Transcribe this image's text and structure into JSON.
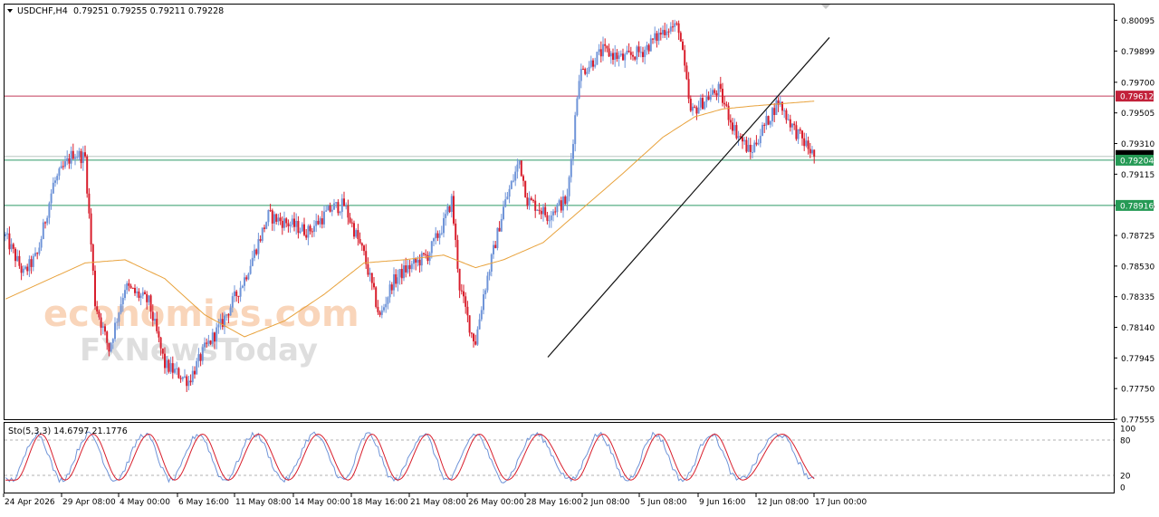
{
  "header": {
    "symbol_label": "USDCHF,H4",
    "ohlc_values": "0.79251 0.79255 0.79211 0.79228"
  },
  "watermark": {
    "line1": "economies.com",
    "line2": "FXNewsToday"
  },
  "indicator": {
    "label": "Sto(5,3,3) 14.6797 21.1776"
  },
  "colors": {
    "bull_candle": "#6f94d8",
    "bear_candle": "#d81e2c",
    "ma_line": "#e8a23c",
    "trendline": "#111111",
    "resistance_line": "#c23a5a",
    "support_line": "#2e9a68",
    "stoch_main": "#6f94d8",
    "stoch_signal": "#d81e2c",
    "price_badge_red": "#c2213a",
    "price_badge_green": "#259a55"
  },
  "chart_data": {
    "type": "candlestick",
    "symbol": "USDCHF",
    "timeframe": "H4",
    "ylim": [
      0.77555,
      0.80195
    ],
    "y_ticks": [
      "0.80095",
      "0.79899",
      "0.79700",
      "0.79505",
      "0.79310",
      "0.79115",
      "0.78916",
      "0.78725",
      "0.78530",
      "0.78335",
      "0.78140",
      "0.77945",
      "0.77750",
      "0.77555"
    ],
    "x_ticks": [
      "24 Apr 2026",
      "29 Apr 08:00",
      "4 May 00:00",
      "6 May 16:00",
      "11 May 08:00",
      "14 May 00:00",
      "18 May 16:00",
      "21 May 08:00",
      "26 May 00:00",
      "28 May 16:00",
      "2 Jun 08:00",
      "5 Jun 08:00",
      "9 Jun 16:00",
      "12 Jun 08:00",
      "17 Jun 00:00"
    ],
    "candle_count": 272,
    "path_anchors": [
      [
        0,
        0.7872
      ],
      [
        9,
        0.7848
      ],
      [
        16,
        0.786
      ],
      [
        24,
        0.7905
      ],
      [
        34,
        0.7925
      ],
      [
        40,
        0.7922
      ],
      [
        45,
        0.783
      ],
      [
        52,
        0.78
      ],
      [
        60,
        0.784
      ],
      [
        72,
        0.783
      ],
      [
        80,
        0.779
      ],
      [
        92,
        0.778
      ],
      [
        100,
        0.78
      ],
      [
        108,
        0.7815
      ],
      [
        120,
        0.7845
      ],
      [
        132,
        0.7885
      ],
      [
        142,
        0.788
      ],
      [
        152,
        0.7875
      ],
      [
        164,
        0.789
      ],
      [
        170,
        0.7892
      ],
      [
        180,
        0.786
      ],
      [
        188,
        0.782
      ],
      [
        194,
        0.7842
      ],
      [
        200,
        0.785
      ],
      [
        212,
        0.786
      ],
      [
        220,
        0.788
      ],
      [
        224,
        0.7895
      ],
      [
        228,
        0.784
      ],
      [
        234,
        0.781
      ],
      [
        236,
        0.7805
      ],
      [
        240,
        0.7835
      ],
      [
        250,
        0.789
      ],
      [
        258,
        0.792
      ],
      [
        262,
        0.7895
      ],
      [
        268,
        0.789
      ],
      [
        272,
        0.7885
      ],
      [
        276,
        0.789
      ],
      [
        282,
        0.7895
      ],
      [
        288,
        0.7975
      ],
      [
        300,
        0.799
      ],
      [
        310,
        0.7985
      ],
      [
        320,
        0.799
      ],
      [
        332,
        0.8005
      ],
      [
        338,
        0.8005
      ],
      [
        344,
        0.795
      ],
      [
        352,
        0.796
      ],
      [
        358,
        0.7965
      ],
      [
        366,
        0.794
      ],
      [
        374,
        0.7925
      ],
      [
        380,
        0.794
      ],
      [
        388,
        0.7958
      ],
      [
        396,
        0.794
      ],
      [
        402,
        0.793
      ],
      [
        406,
        0.7923
      ]
    ],
    "moving_average_anchors": [
      [
        0,
        0.7832
      ],
      [
        40,
        0.7855
      ],
      [
        60,
        0.7857
      ],
      [
        80,
        0.7845
      ],
      [
        100,
        0.7822
      ],
      [
        120,
        0.7808
      ],
      [
        140,
        0.7818
      ],
      [
        160,
        0.7835
      ],
      [
        180,
        0.7855
      ],
      [
        200,
        0.7857
      ],
      [
        220,
        0.786
      ],
      [
        236,
        0.7852
      ],
      [
        250,
        0.7857
      ],
      [
        270,
        0.7868
      ],
      [
        290,
        0.789
      ],
      [
        310,
        0.7912
      ],
      [
        330,
        0.7935
      ],
      [
        346,
        0.7948
      ],
      [
        360,
        0.7953
      ],
      [
        376,
        0.7955
      ],
      [
        406,
        0.7958
      ]
    ],
    "trendline": {
      "from": [
        0.7795,
        "28 May 16:00"
      ],
      "to": [
        0.79985,
        "beyond 17 Jun 00:00"
      ]
    },
    "horizontal_levels": [
      {
        "value": "0.79612",
        "kind": "resistance",
        "badge": "red"
      },
      {
        "value": "0.79204",
        "kind": "support",
        "badge": "green",
        "current_price": "0.79228"
      },
      {
        "value": "0.78916",
        "kind": "support",
        "badge": "green"
      }
    ],
    "stochastic": {
      "params": "5,3,3",
      "main": "14.6797",
      "signal": "21.1776",
      "scale_labels": [
        "100",
        "80",
        "20",
        "0"
      ],
      "cycle_lows": [
        3,
        28,
        55,
        83,
        110,
        140,
        170,
        195,
        222,
        250,
        284,
        312,
        340,
        368,
        406
      ],
      "cycle_highs": [
        16,
        42,
        70,
        97,
        125,
        155,
        182,
        210,
        236,
        266,
        298,
        326,
        354,
        388
      ]
    }
  }
}
